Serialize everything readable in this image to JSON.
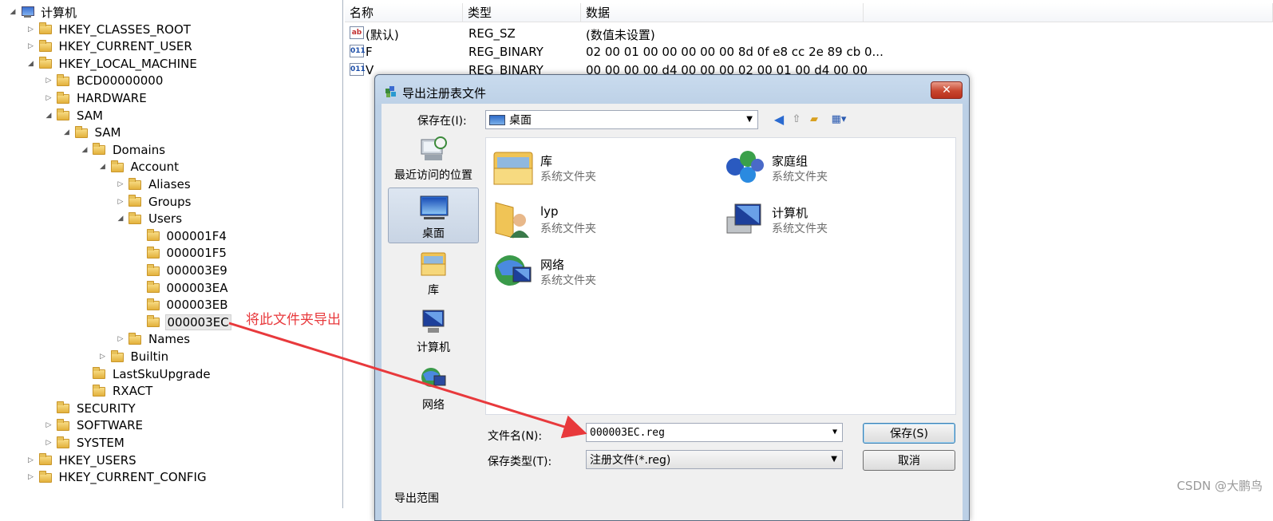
{
  "tree": {
    "root": "计算机",
    "nodes": [
      {
        "label": "HKEY_CLASSES_ROOT",
        "exp": "▷"
      },
      {
        "label": "HKEY_CURRENT_USER",
        "exp": "▷"
      },
      {
        "label": "HKEY_LOCAL_MACHINE",
        "exp": "◢"
      },
      {
        "label": "BCD00000000",
        "exp": "▷"
      },
      {
        "label": "HARDWARE",
        "exp": "▷"
      },
      {
        "label": "SAM",
        "exp": "◢"
      },
      {
        "label": "SAM",
        "exp": "◢"
      },
      {
        "label": "Domains",
        "exp": "◢"
      },
      {
        "label": "Account",
        "exp": "◢"
      },
      {
        "label": "Aliases",
        "exp": "▷"
      },
      {
        "label": "Groups",
        "exp": "▷"
      },
      {
        "label": "Users",
        "exp": "◢"
      },
      {
        "label": "000001F4",
        "exp": ""
      },
      {
        "label": "000001F5",
        "exp": ""
      },
      {
        "label": "000003E9",
        "exp": ""
      },
      {
        "label": "000003EA",
        "exp": ""
      },
      {
        "label": "000003EB",
        "exp": ""
      },
      {
        "label": "000003EC",
        "exp": ""
      },
      {
        "label": "Names",
        "exp": "▷"
      },
      {
        "label": "Builtin",
        "exp": "▷"
      },
      {
        "label": "LastSkuUpgrade",
        "exp": ""
      },
      {
        "label": "RXACT",
        "exp": ""
      },
      {
        "label": "SECURITY",
        "exp": ""
      },
      {
        "label": "SOFTWARE",
        "exp": "▷"
      },
      {
        "label": "SYSTEM",
        "exp": "▷"
      },
      {
        "label": "HKEY_USERS",
        "exp": "▷"
      },
      {
        "label": "HKEY_CURRENT_CONFIG",
        "exp": "▷"
      }
    ]
  },
  "values": {
    "headers": [
      "名称",
      "类型",
      "数据"
    ],
    "rows": [
      {
        "icon": "ab",
        "name": "(默认)",
        "type": "REG_SZ",
        "data": "(数值未设置)"
      },
      {
        "icon": "bin",
        "name": "F",
        "type": "REG_BINARY",
        "data": "02 00 01 00 00 00 00 00 8d 0f e8 cc 2e 89 cb 0..."
      },
      {
        "icon": "bin",
        "name": "V",
        "type": "REG_BINARY",
        "data": "00 00 00 00 d4 00 00 00 02 00 01 00 d4 00 00"
      }
    ]
  },
  "dialog": {
    "title": "导出注册表文件",
    "close_label": "✕",
    "save_in_label": "保存在(I):",
    "save_in_value": "桌面",
    "places": [
      "最近访问的位置",
      "桌面",
      "库",
      "计算机",
      "网络"
    ],
    "items": [
      {
        "name": "库",
        "sub": "系统文件夹"
      },
      {
        "name": "家庭组",
        "sub": "系统文件夹"
      },
      {
        "name": "lyp",
        "sub": "系统文件夹"
      },
      {
        "name": "计算机",
        "sub": "系统文件夹"
      },
      {
        "name": "网络",
        "sub": "系统文件夹"
      }
    ],
    "filename_label": "文件名(N):",
    "filename_value": "000003EC.reg",
    "filetype_label": "保存类型(T):",
    "filetype_value": "注册文件(*.reg)",
    "save_button": "保存(S)",
    "cancel_button": "取消",
    "export_range_label": "导出范围"
  },
  "annotation": "将此文件夹导出",
  "watermark": "CSDN @大鹏鸟",
  "colors": {
    "annotation": "#e8393c",
    "selection": "#e8e8e8"
  }
}
